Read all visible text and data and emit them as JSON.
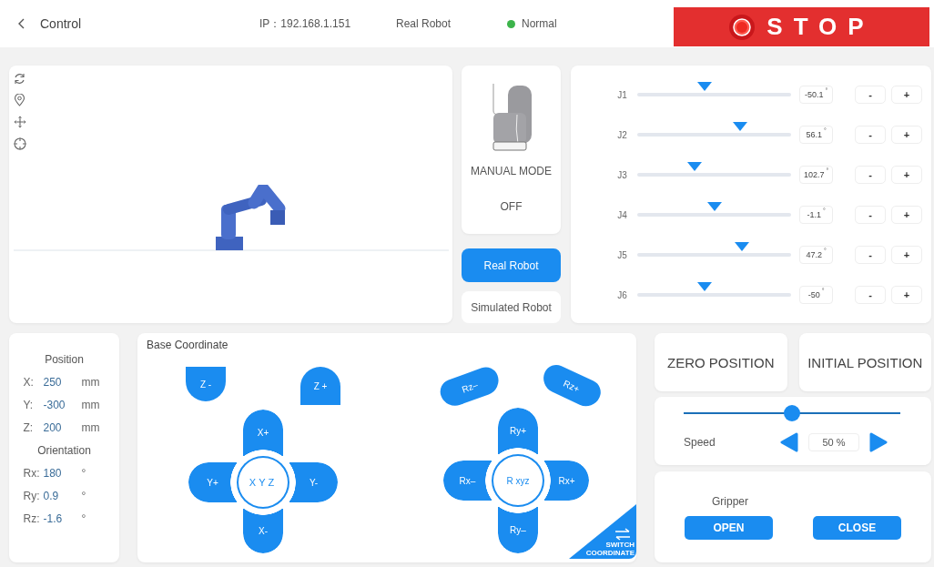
{
  "header": {
    "title": "Control",
    "ip": "IP：192.168.1.151",
    "mode": "Real Robot",
    "status": {
      "label": "Normal",
      "color": "#3cb44b"
    },
    "stop_label": "STOP"
  },
  "manual_mode": {
    "label": "MANUAL MODE",
    "state": "OFF"
  },
  "robot_source": [
    {
      "label": "Real Robot",
      "selected": true
    },
    {
      "label": "Simulated Robot",
      "selected": false
    }
  ],
  "joints": [
    {
      "name": "J1",
      "level": 0.44,
      "value": "-50.1",
      "unit": "°",
      "minus": "-",
      "plus": "+"
    },
    {
      "name": "J2",
      "level": 0.67,
      "value": "56.1",
      "unit": "°",
      "minus": "-",
      "plus": "+"
    },
    {
      "name": "J3",
      "level": 0.37,
      "value": "102.7",
      "unit": "°",
      "minus": "-",
      "plus": "+"
    },
    {
      "name": "J4",
      "level": 0.5,
      "value": "-1.1",
      "unit": "°",
      "minus": "-",
      "plus": "+"
    },
    {
      "name": "J5",
      "level": 0.68,
      "value": "47.2",
      "unit": "°",
      "minus": "-",
      "plus": "+"
    },
    {
      "name": "J6",
      "level": 0.44,
      "value": "-50",
      "unit": "°",
      "minus": "-",
      "plus": "+"
    }
  ],
  "position": {
    "title": "Position",
    "rows": [
      {
        "axis": "X:",
        "value": "250",
        "unit": "mm"
      },
      {
        "axis": "Y:",
        "value": "-300",
        "unit": "mm"
      },
      {
        "axis": "Z:",
        "value": "200",
        "unit": "mm"
      }
    ],
    "orientation_title": "Orientation",
    "orientation_rows": [
      {
        "axis": "Rx:",
        "value": "180",
        "unit": "°"
      },
      {
        "axis": "Ry:",
        "value": "0.9",
        "unit": "°"
      },
      {
        "axis": "Rz:",
        "value": "-1.6",
        "unit": "°"
      }
    ]
  },
  "coordinate_panel": {
    "title": "Base Coordinate",
    "buttons": [
      {
        "kind": "z-minus",
        "label": "Z -"
      },
      {
        "kind": "z-plus",
        "label": "Z +"
      },
      {
        "kind": "x-plus",
        "label": "X+"
      },
      {
        "kind": "y-plus",
        "label": "Y+"
      },
      {
        "kind": "xyz-center",
        "label": "XYZ"
      },
      {
        "kind": "y-minus",
        "label": "Y-"
      },
      {
        "kind": "x-minus",
        "label": "X-"
      },
      {
        "kind": "rz-minus",
        "label": "Rz–"
      },
      {
        "kind": "rz-plus",
        "label": "Rz+"
      },
      {
        "kind": "ry-plus",
        "label": "Ry+"
      },
      {
        "kind": "rx-minus",
        "label": "Rx–"
      },
      {
        "kind": "rxyz-center",
        "label": "R xyz"
      },
      {
        "kind": "rx-plus",
        "label": "Rx+"
      },
      {
        "kind": "ry-minus",
        "label": "Ry–"
      },
      {
        "kind": "switch",
        "label": "SWITCH COORDINATE"
      }
    ]
  },
  "position_buttons": [
    "ZERO POSITION",
    "INITIAL POSITION"
  ],
  "speed": {
    "label": "Speed",
    "level": 0.5,
    "value": "50 %"
  },
  "gripper": {
    "label": "Gripper",
    "open": "OPEN",
    "close": "CLOSE"
  }
}
